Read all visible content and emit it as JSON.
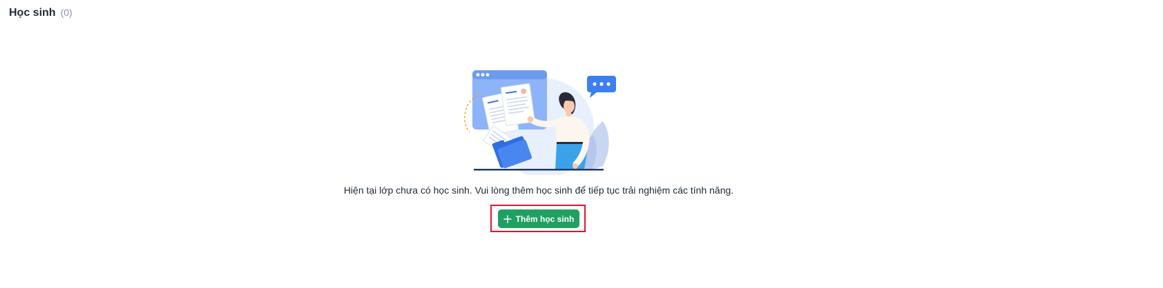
{
  "header": {
    "title": "Học sinh",
    "count": "(0)"
  },
  "empty_state": {
    "message": "Hiện tại lớp chưa có học sinh. Vui lòng thêm học sinh để tiếp tục trải nghiệm các tính năng.",
    "button_label": "Thêm học sinh",
    "button_icon": "plus-icon",
    "illustration": "empty-students-illustration"
  },
  "colors": {
    "primary_button": "#1fa061",
    "highlight_border": "#e3132b",
    "count_text": "#8b8fa3"
  }
}
